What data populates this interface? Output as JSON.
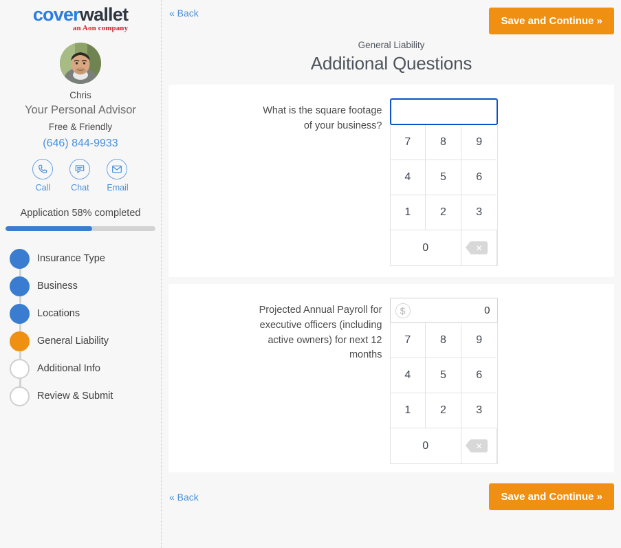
{
  "brand": {
    "logo_cover": "cover",
    "logo_wallet": "wallet",
    "logo_tagline": "an Aon company",
    "accent_blue": "#2a7de1",
    "accent_orange": "#ef9013",
    "accent_red": "#d8232a"
  },
  "advisor": {
    "avatar_name": "advisor-photo",
    "name": "Chris",
    "role": "Your Personal Advisor",
    "tagline": "Free & Friendly",
    "phone": "(646) 844-9933",
    "contacts": [
      {
        "icon": "phone-icon",
        "label": "Call"
      },
      {
        "icon": "chat-icon",
        "label": "Chat"
      },
      {
        "icon": "email-icon",
        "label": "Email"
      }
    ]
  },
  "progress": {
    "text": "Application 58% completed",
    "percent": 58,
    "fill_color": "#3a7dd0",
    "track_color": "#d3d3d3"
  },
  "steps": [
    {
      "label": "Insurance Type",
      "state": "done"
    },
    {
      "label": "Business",
      "state": "done"
    },
    {
      "label": "Locations",
      "state": "done"
    },
    {
      "label": "General Liability",
      "state": "current"
    },
    {
      "label": "Additional Info",
      "state": "todo"
    },
    {
      "label": "Review & Submit",
      "state": "todo"
    }
  ],
  "header": {
    "back_label": "« Back",
    "save_label": "Save and Continue »",
    "subtitle": "General Liability",
    "title": "Additional Questions"
  },
  "footer": {
    "back_label": "« Back",
    "save_label": "Save and Continue »"
  },
  "questions": [
    {
      "label": "What is the square footage of your business?",
      "value": "",
      "placeholder": "",
      "focused": true,
      "prefix_icon": null,
      "keys": [
        "7",
        "8",
        "9",
        "4",
        "5",
        "6",
        "1",
        "2",
        "3",
        "0"
      ],
      "backspace_icon": "backspace-icon"
    },
    {
      "label": "Projected Annual Payroll for executive officers (including active owners) for next 12 months",
      "value": "0",
      "placeholder": "",
      "focused": false,
      "prefix_icon": "dollar-icon",
      "prefix_symbol": "$",
      "keys": [
        "7",
        "8",
        "9",
        "4",
        "5",
        "6",
        "1",
        "2",
        "3",
        "0"
      ],
      "backspace_icon": "backspace-icon"
    }
  ]
}
